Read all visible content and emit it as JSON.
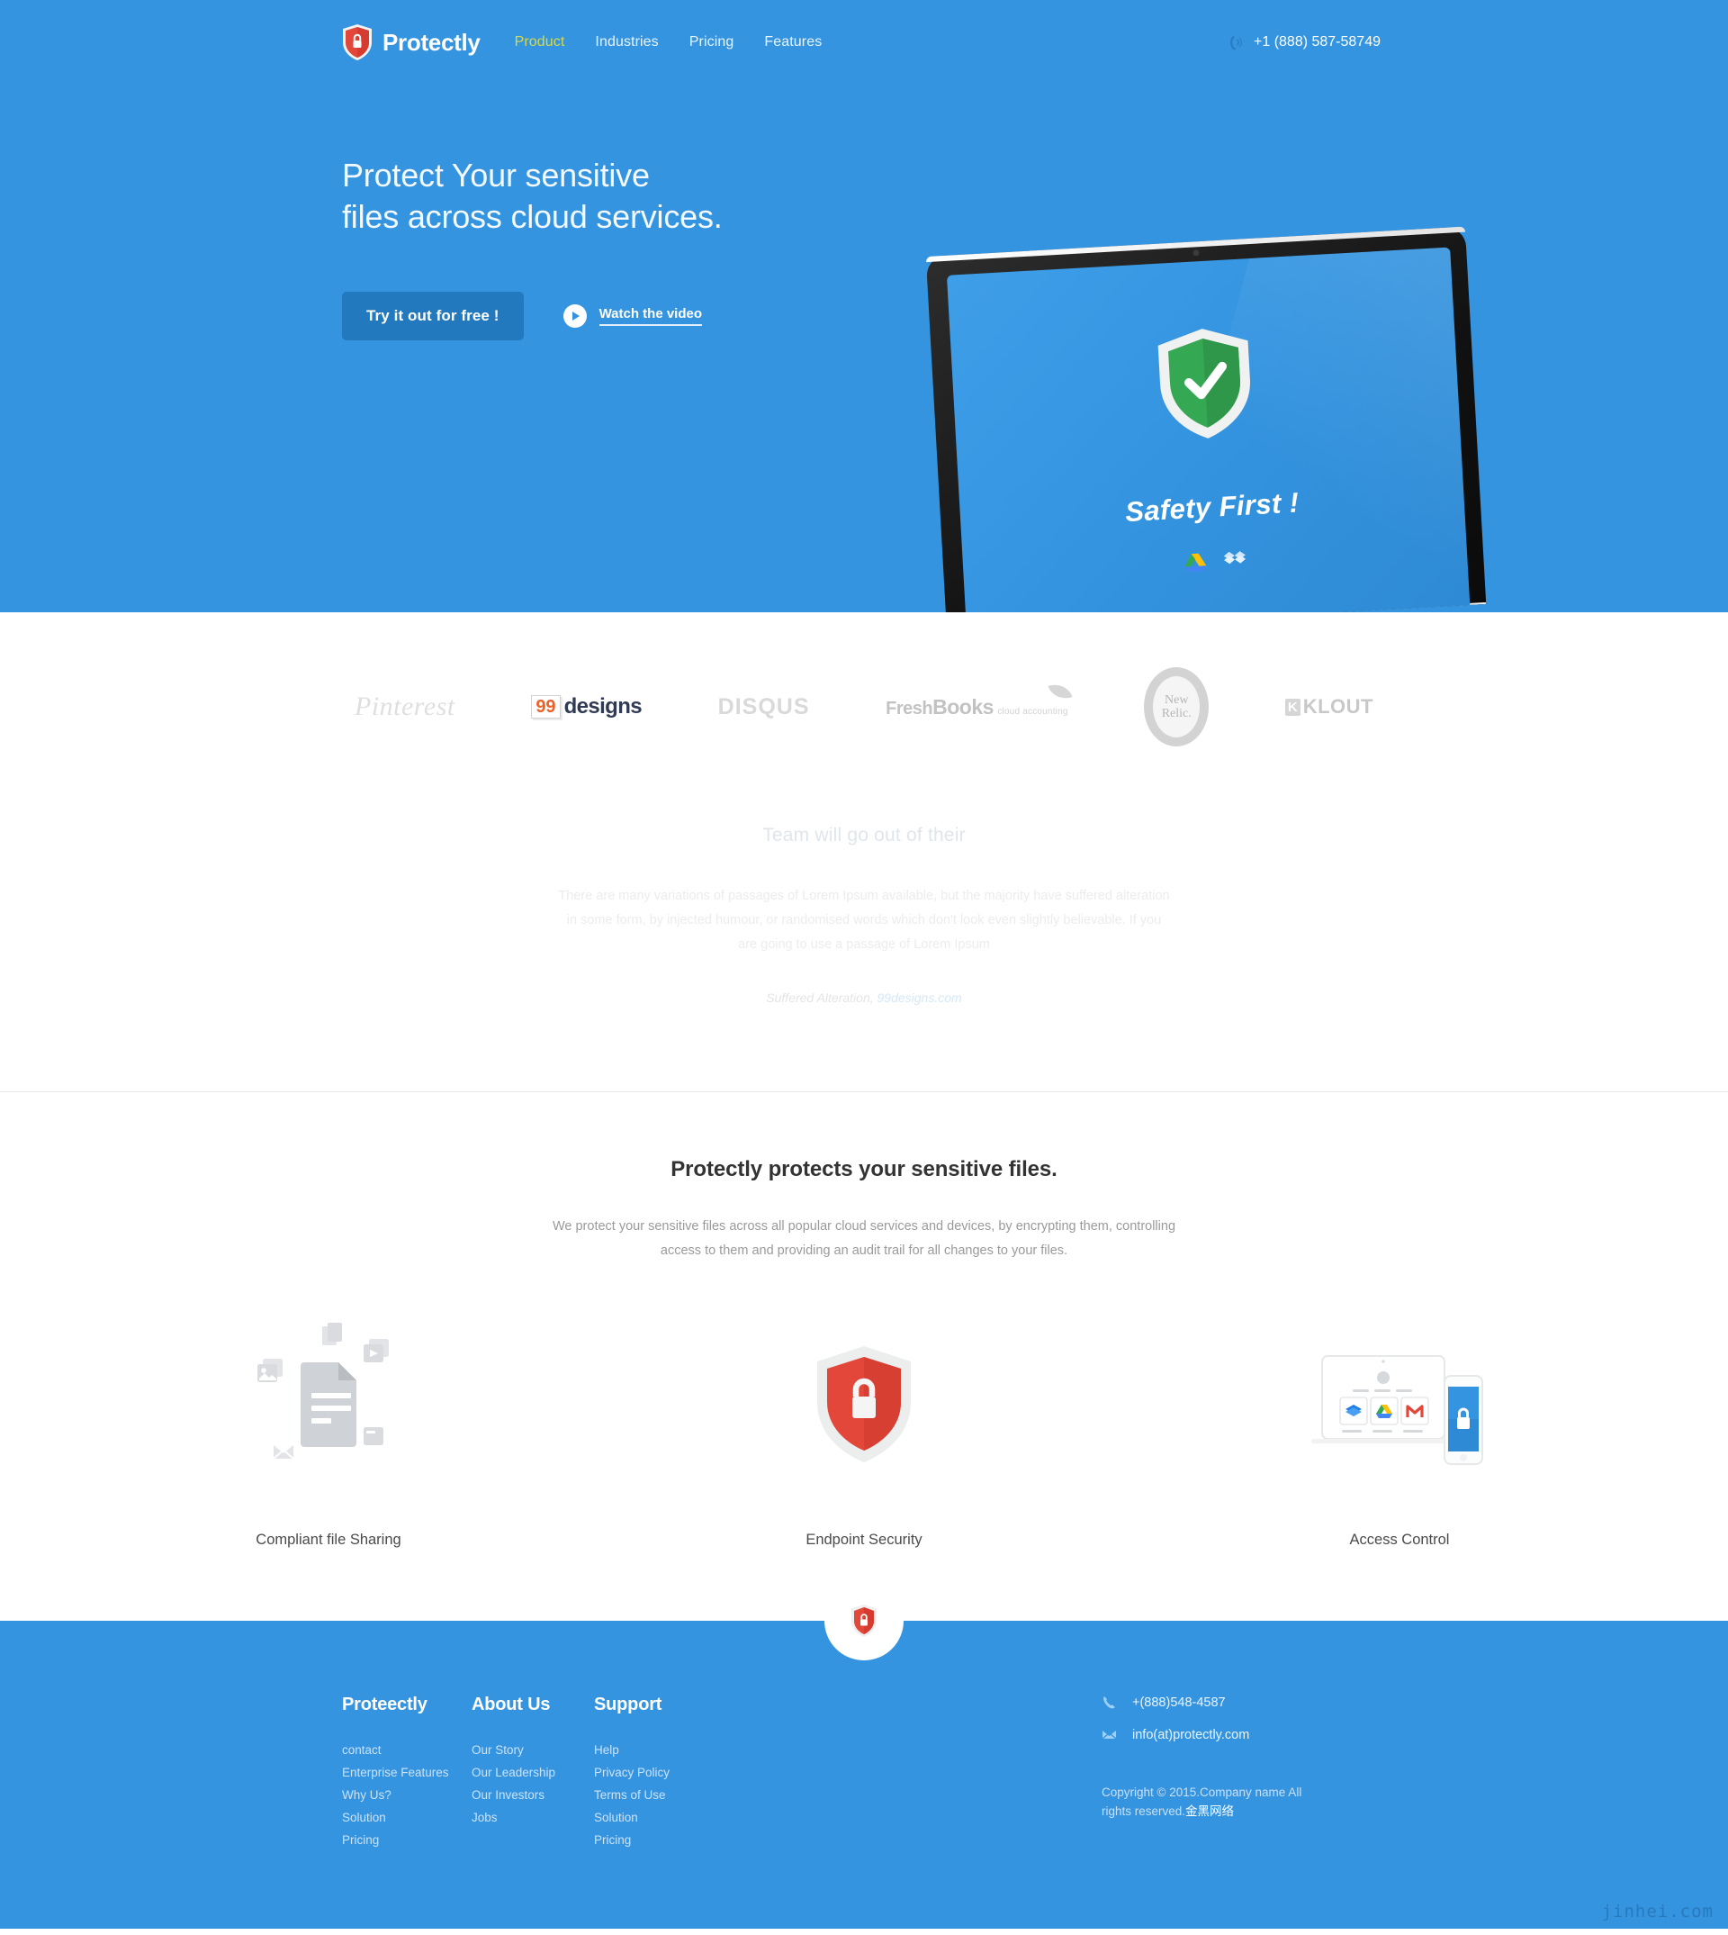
{
  "colors": {
    "brand_blue": "#3494e0",
    "button_blue": "#2279bd",
    "accent_yellow": "#d8d94a",
    "shield_red": "#e2473a",
    "shield_green": "#34a853",
    "link_grey": "#cde3f6"
  },
  "header": {
    "logo_icon": "shield-lock-icon",
    "brand": "Protectly",
    "nav": [
      {
        "label": "Product",
        "active": true
      },
      {
        "label": "Industries",
        "active": false
      },
      {
        "label": "Pricing",
        "active": false
      },
      {
        "label": "Features",
        "active": false
      }
    ],
    "phone_icon": "phone-ringing-icon",
    "phone": "+1 (888) 587-58749"
  },
  "hero": {
    "title_line1": "Protect Your sensitive",
    "title_line2": "files across cloud services.",
    "cta_label": "Try it out for free !",
    "video_icon": "play-circle-icon",
    "video_label": "Watch the video",
    "device": {
      "screen_icon": "green-shield-check-icon",
      "screen_caption": "Safety First !",
      "app_icons": [
        "google-drive-icon",
        "dropbox-icon"
      ]
    }
  },
  "logos": [
    {
      "name": "Pinterest",
      "icon": "pinterest-logo"
    },
    {
      "name": "99designs",
      "icon": "99designs-logo",
      "badge": "99",
      "word": "designs"
    },
    {
      "name": "DISQUS",
      "icon": "disqus-logo"
    },
    {
      "name": "FreshBooks",
      "icon": "freshbooks-logo",
      "main_a": "Fresh",
      "main_b": "Books",
      "sub": "cloud accounting"
    },
    {
      "name": "New Relic",
      "icon": "newrelic-logo",
      "line1": "New",
      "line2": "Relic."
    },
    {
      "name": "KLOUT",
      "icon": "klout-logo",
      "mark": "K",
      "word": "KLOUT"
    }
  ],
  "testimonial": {
    "title": "Team will go out of their",
    "body": "There are many variations of passages of Lorem Ipsum available, but the majority have suffered alteration in some form, by injected humour, or randomised words which don't look even slightly believable. If you are going to use a passage of Lorem Ipsum",
    "attribution_text": "Suffered Alteration,",
    "attribution_link": "99designs.com",
    "prev_icon": "chevron-left-icon",
    "next_icon": "chevron-right-icon"
  },
  "features": {
    "heading": "Protectly protects your sensitive files.",
    "subheading": "We protect your sensitive files across all popular cloud services and devices, by encrypting them, controlling access to them and providing an audit trail for all changes to your files.",
    "items": [
      {
        "label": "Compliant file Sharing",
        "icon": "documents-sharing-icon"
      },
      {
        "label": "Endpoint Security",
        "icon": "red-shield-lock-icon"
      },
      {
        "label": "Access Control",
        "icon": "laptop-phone-cloud-apps-icon"
      }
    ]
  },
  "footer": {
    "badge_icon": "shield-lock-badge-icon",
    "columns": [
      {
        "title": "Proteectly",
        "links": [
          "contact",
          "Enterprise Features",
          "Why Us?",
          "Solution",
          "Pricing"
        ]
      },
      {
        "title": "About Us",
        "links": [
          "Our Story",
          "Our Leadership",
          "Our Investors",
          "Jobs"
        ]
      },
      {
        "title": "Support",
        "links": [
          "Help",
          "Privacy Policy",
          "Terms of Use",
          "Solution",
          "Pricing"
        ]
      }
    ],
    "contact": {
      "phone_icon": "phone-handset-icon",
      "phone": "+(888)548-4587",
      "email_icon": "envelope-icon",
      "email": "info(at)protectly.com"
    },
    "copyright_text": "Copyright © 2015.Company name All rights reserved.",
    "copyright_link": "金黑网络",
    "watermark": "jinhei.com"
  }
}
